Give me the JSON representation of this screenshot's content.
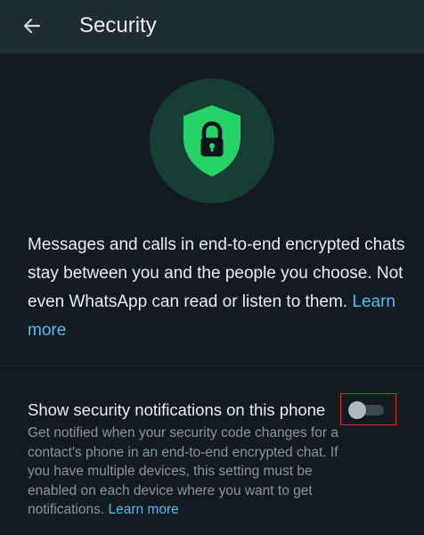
{
  "header": {
    "title": "Security",
    "back_icon": "arrow-left-icon"
  },
  "hero": {
    "icon": "shield-lock-icon",
    "circle_color": "#173d34",
    "shield_color": "#25d366"
  },
  "intro": {
    "text": "Messages and calls in end-to-end encrypted chats stay between you and the people you choose. Not even WhatsApp can read or listen to them.",
    "link": "Learn more"
  },
  "security_notifications": {
    "title": "Show security notifications on this phone",
    "description": "Get notified when your security code changes for a contact's phone in an end-to-end encrypted chat. If you have multiple devices, this setting must be enabled on each device where you want to get notifications.",
    "link": "Learn more",
    "enabled": false
  },
  "colors": {
    "background": "#111b21",
    "header": "#1f2c34",
    "link": "#53bdeb",
    "secondary_text": "#8696a0",
    "highlight_box": "#d32f2f"
  }
}
